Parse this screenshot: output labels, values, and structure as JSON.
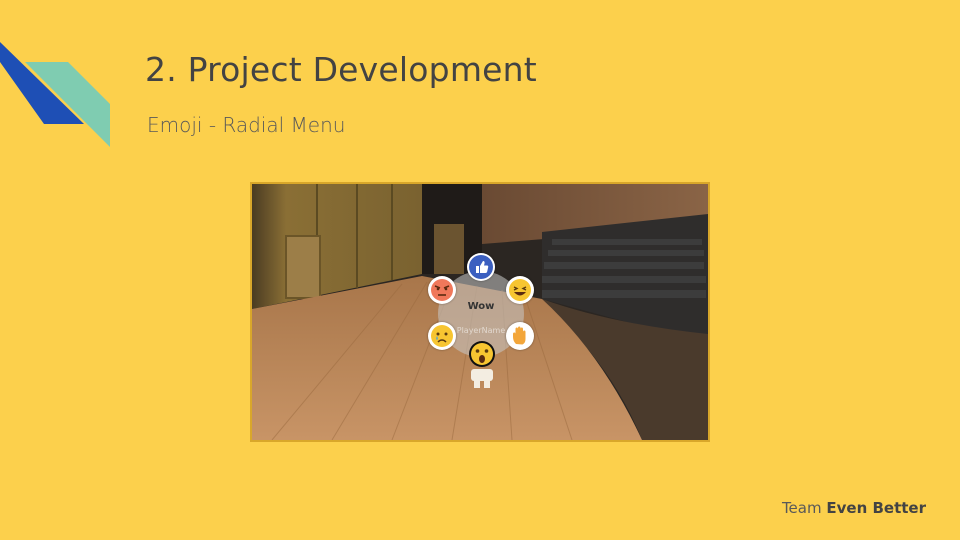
{
  "slide": {
    "title": "2. Project Development",
    "subtitle": "Emoji - Radial Menu",
    "footer_prefix": "Team",
    "footer_team": "Even Better"
  },
  "colors": {
    "background": "#FCD04C",
    "accent_blue": "#1E4FB5",
    "accent_teal": "#7FCCB1",
    "frame_border": "#D9A72A"
  },
  "radial_menu": {
    "selected_label": "Wow",
    "player_name": "PlayerName",
    "options": [
      {
        "icon": "thumbs-up-icon"
      },
      {
        "icon": "laughing-face-icon"
      },
      {
        "icon": "raised-hand-icon"
      },
      {
        "icon": "wow-face-icon"
      },
      {
        "icon": "crying-face-icon"
      },
      {
        "icon": "angry-face-icon"
      }
    ]
  }
}
